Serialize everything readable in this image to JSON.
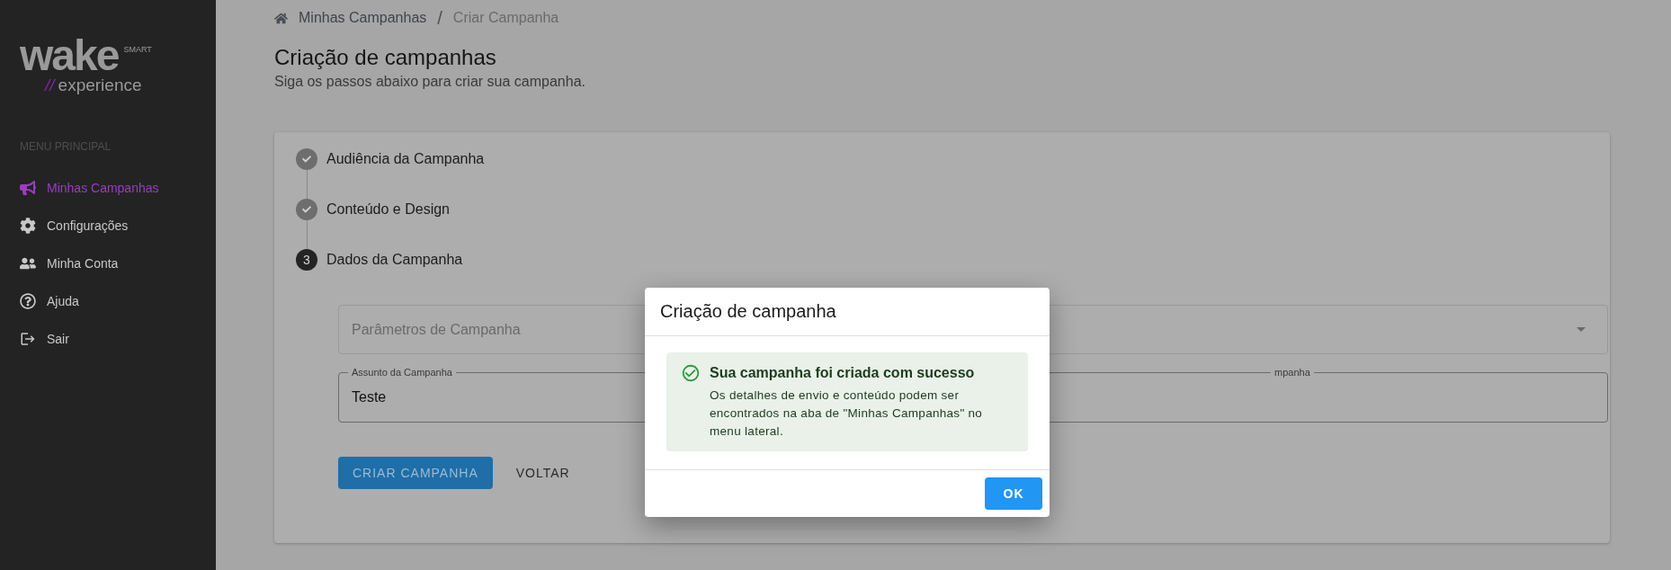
{
  "sidebar": {
    "logo": {
      "word": "wake",
      "badge": "SMART",
      "slashes": "//",
      "tagline": "experience"
    },
    "section_title": "MENU PRINCIPAL",
    "items": [
      {
        "label": "Minhas Campanhas",
        "selected": true
      },
      {
        "label": "Configurações",
        "selected": false
      },
      {
        "label": "Minha Conta",
        "selected": false
      },
      {
        "label": "Ajuda",
        "selected": false
      },
      {
        "label": "Sair",
        "selected": false
      }
    ]
  },
  "breadcrumb": [
    {
      "label": "Minhas Campanhas",
      "current": false
    },
    {
      "label": "Criar Campanha",
      "current": true
    }
  ],
  "breadcrumb_separator": "/",
  "page": {
    "title": "Criação de campanhas",
    "subtitle": "Siga os passos abaixo para criar sua campanha."
  },
  "stepper": [
    {
      "label": "Audiência da Campanha",
      "completed": true
    },
    {
      "label": "Conteúdo e Design",
      "completed": true
    },
    {
      "number": "3",
      "label": "Dados da Campanha",
      "completed": false
    }
  ],
  "form": {
    "select": {
      "placeholder": "Parâmetros de Campanha"
    },
    "fields": [
      {
        "label": "Assunto da Campanha",
        "value": "Teste"
      },
      {
        "label": "mpanha"
      }
    ],
    "buttons": [
      {
        "label": "CRIAR CAMPANHA",
        "kind": "primary"
      },
      {
        "label": "VOLTAR",
        "kind": "text"
      }
    ]
  },
  "dialog": {
    "title": "Criação de campanha",
    "alert": {
      "title": "Sua campanha foi criada com sucesso",
      "message": "Os detalhes de envio e conteúdo podem ser encontrados na aba de \"Minhas Campanhas\" no menu lateral."
    },
    "button": "OK"
  }
}
